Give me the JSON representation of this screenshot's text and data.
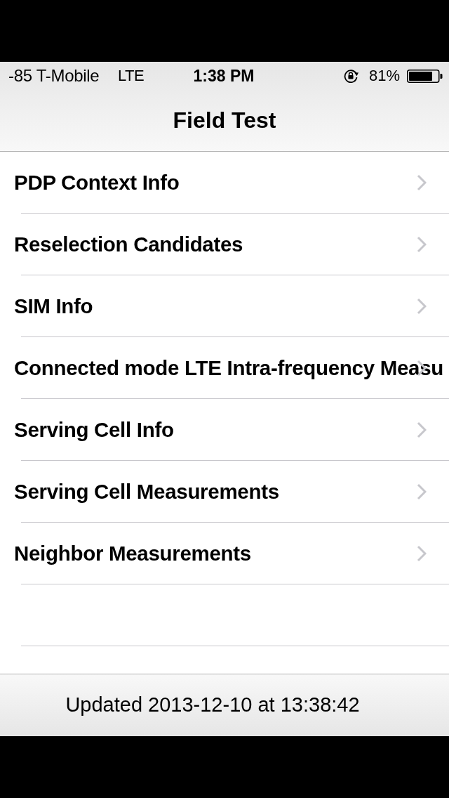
{
  "status_bar": {
    "carrier": "-85 T-Mobile",
    "network": "LTE",
    "time": "1:38 PM",
    "battery_percent": "81%"
  },
  "nav_bar": {
    "title": "Field Test"
  },
  "menu_items": [
    {
      "label": "PDP Context Info"
    },
    {
      "label": "Reselection Candidates"
    },
    {
      "label": "SIM Info"
    },
    {
      "label": "Connected mode LTE Intra-frequency Measu"
    },
    {
      "label": "Serving Cell Info"
    },
    {
      "label": "Serving Cell Measurements"
    },
    {
      "label": "Neighbor Measurements"
    }
  ],
  "toolbar": {
    "text": "Updated 2013-12-10 at 13:38:42"
  }
}
